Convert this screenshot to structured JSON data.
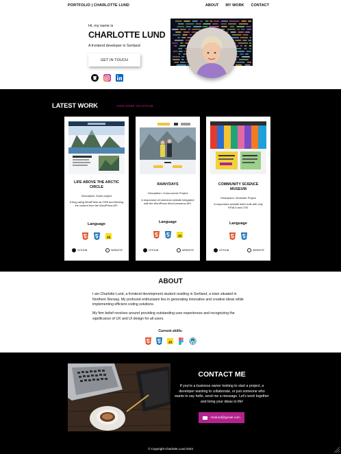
{
  "nav": {
    "brand": "PORTFOLIO | CHARLOTTE LUND",
    "links": [
      "ABOUT",
      "MY WORK",
      "CONTACT"
    ]
  },
  "hero": {
    "greeting": "Hi, my name is",
    "name": "CHARLOTTE LUND",
    "tagline": "A frontend developer in Sortland",
    "cta": "GET IN TOUCH",
    "socials": [
      "github-icon",
      "instagram-icon",
      "linkedin-icon"
    ]
  },
  "work": {
    "heading": "LATEST WORK",
    "more_link": "VIEW MORE ON GITHUB",
    "cards": [
      {
        "title": "LIFE ABOVE THE ARCTIC CIRCLE",
        "subtitle": "Description: Exam project",
        "description": "A blog using WordPress as CMS and fetching the content from the WordPress API.",
        "lang_label": "Language",
        "languages": [
          "html5",
          "css3",
          "javascript"
        ],
        "github": "GITHUB",
        "website": "WEBSITE"
      },
      {
        "title": "RAINYDAYS",
        "subtitle": "Description: Cross-course Project",
        "description": "A responsive eCommerce website integrated with the WordPress WooCommerce API.",
        "lang_label": "Language",
        "languages": [
          "html5",
          "css3",
          "javascript"
        ],
        "github": "GITHUB",
        "website": "WEBSITE"
      },
      {
        "title": "COMMUNITY SCIENCE MUSEUM",
        "subtitle": "Description: Semester Project",
        "description": "A responsive website that's built with only HTML5 and CSS.",
        "lang_label": "Language",
        "languages": [
          "html5",
          "css3"
        ],
        "github": "GITHUB",
        "website": "WEBSITE"
      }
    ]
  },
  "about": {
    "heading": "ABOUT",
    "paragraph1": "I am Charlotte Lund, a frontend development student residing in Sortland, a town situated in Northern Norway. My profound enthusiasm lies in generating innovative and creative ideas while implementing efficient coding solutions.",
    "paragraph2": "My firm belief revolves around providing outstanding user experiences and recognizing the significance of UX and UI design for all users.",
    "skills_label": "Current skills:",
    "skills": [
      "html5",
      "css3",
      "javascript",
      "figma",
      "wordpress"
    ]
  },
  "contact": {
    "heading": "CONTACT ME",
    "message": "If you're a business owner looking to start a project, a developer wanting to collaborate, or just someone who wants to say hello, send me a message. Let's work together and bring your ideas to life!",
    "email": "chalund@gmail.com",
    "copyright": "© Copyright Charlotte Lund 2023"
  },
  "colors": {
    "accent": "#b4228d",
    "dark": "#000000"
  }
}
